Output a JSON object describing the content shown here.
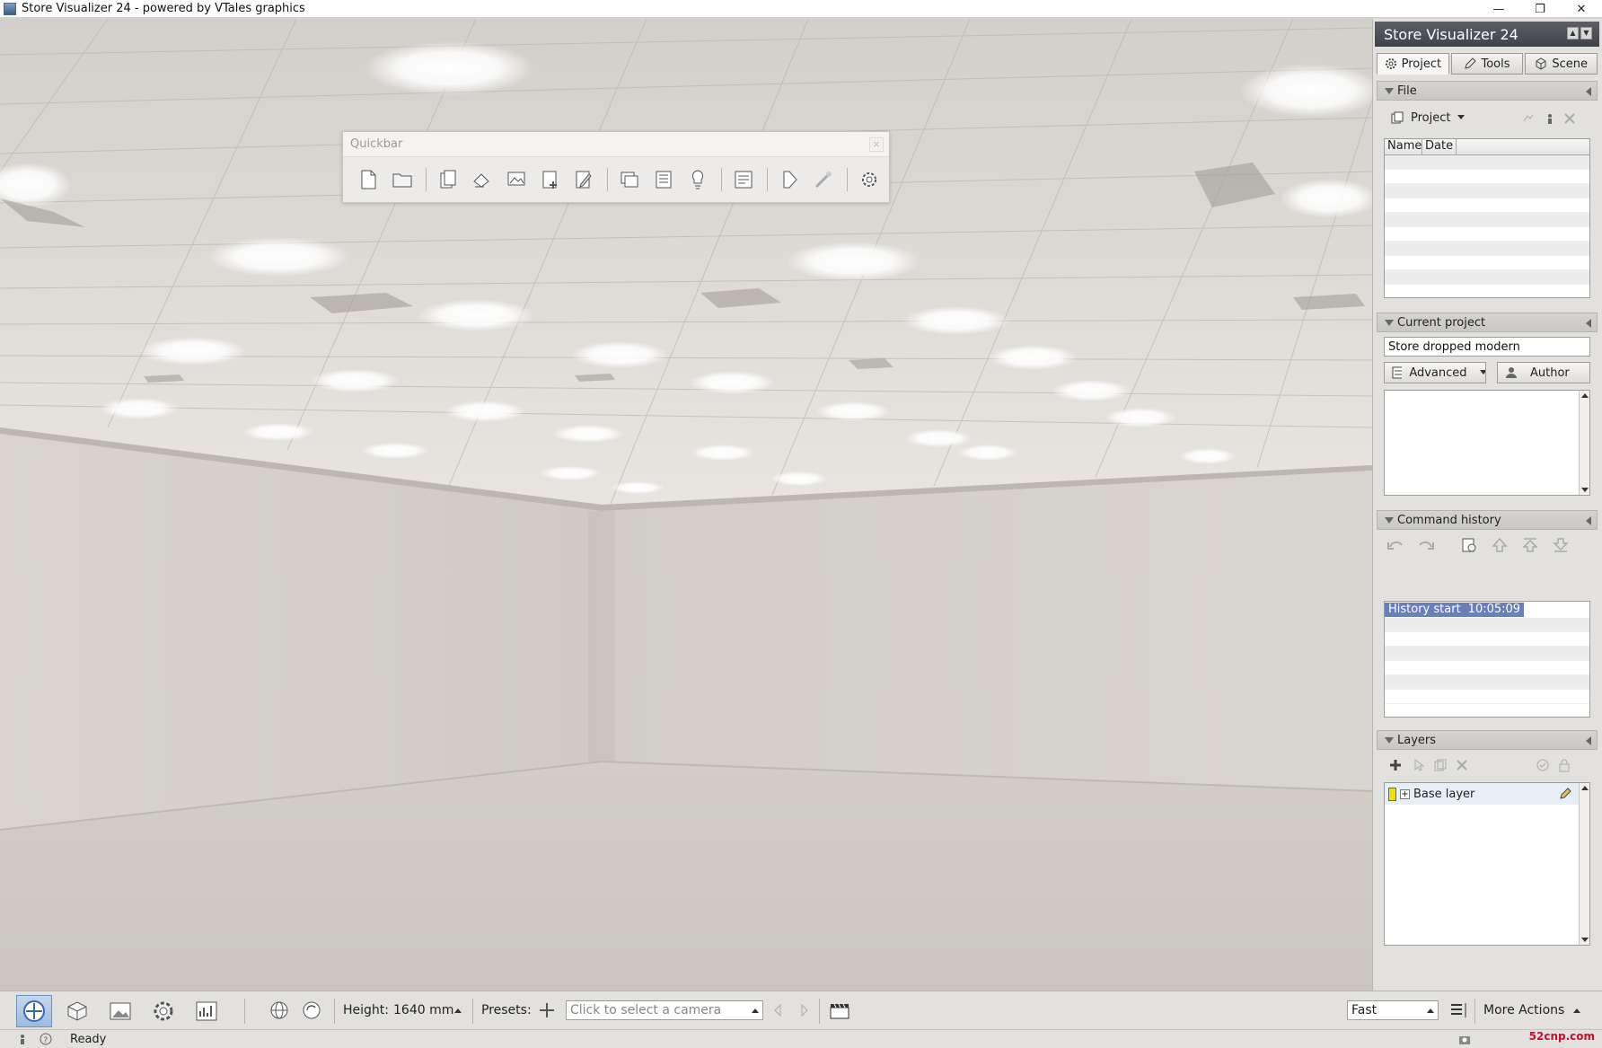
{
  "window": {
    "title": "Store Visualizer 24 - powered by VTales graphics",
    "minimize": "—",
    "restore": "❐",
    "close": "✕"
  },
  "quickbar": {
    "title": "Quickbar",
    "close": "×"
  },
  "dock": {
    "title": "Store Visualizer 24",
    "tabs": [
      {
        "label": "Project",
        "icon": "gear-icon"
      },
      {
        "label": "Tools",
        "icon": "pencil-icon"
      },
      {
        "label": "Scene",
        "icon": "cube-icon"
      }
    ],
    "file": {
      "header": "File",
      "project_dropdown": "Project",
      "columns": [
        "Name",
        "Date"
      ]
    },
    "current_project": {
      "header": "Current project",
      "name_value": "Store dropped modern",
      "mode_dropdown": "Advanced",
      "author_button": "Author"
    },
    "command_history": {
      "header": "Command history",
      "entries": [
        {
          "label": "History start",
          "time": "10:05:09"
        }
      ]
    },
    "layers": {
      "header": "Layers",
      "items": [
        {
          "name": "Base layer",
          "color": "#f3e000"
        }
      ]
    }
  },
  "bottom_toolbar": {
    "height_label": "Height:",
    "height_value": "1640 mm",
    "presets_label": "Presets:",
    "camera_placeholder": "Click to select a camera",
    "quality_value": "Fast",
    "more_actions": "More Actions"
  },
  "status": {
    "text": "Ready",
    "watermark": "52cnp.com"
  },
  "colors": {
    "accent_selection": "#6a7fb8",
    "dock_title": "#4a4d53"
  }
}
